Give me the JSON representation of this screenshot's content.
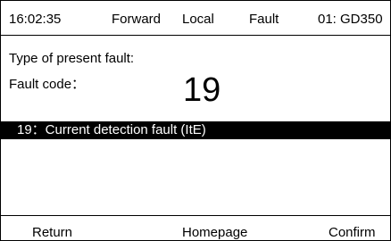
{
  "status_bar": {
    "time": "16:02:35",
    "direction": "Forward",
    "mode": "Local",
    "state": "Fault",
    "device": "01: GD350"
  },
  "fault": {
    "present_label": "Type of present fault:",
    "code_label": "Fault code：",
    "code_value": "19",
    "description": "19：Current detection fault (ItE)"
  },
  "footer": {
    "return_label": "Return",
    "homepage_label": "Homepage",
    "confirm_label": "Confirm"
  }
}
